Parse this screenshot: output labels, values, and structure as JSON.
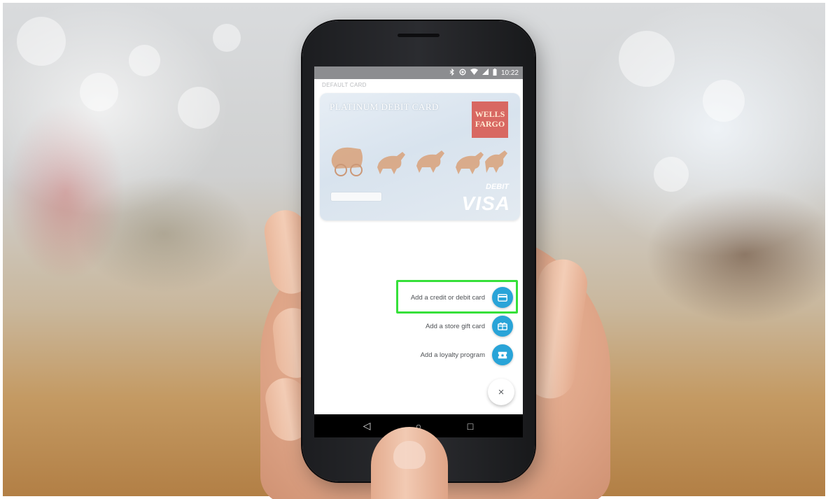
{
  "status_bar": {
    "time": "10:22",
    "icons": [
      "bluetooth-icon",
      "data-saver-icon",
      "wifi-icon",
      "signal-icon",
      "battery-icon"
    ]
  },
  "screen": {
    "section_label": "DEFAULT CARD"
  },
  "card": {
    "name": "PLATINUM DEBIT CARD",
    "bank_logo": "WELLS FARGO",
    "type_label": "DEBIT",
    "network": "VISA"
  },
  "menu": {
    "items": [
      {
        "label": "Add a credit or debit card",
        "icon": "credit-card-icon"
      },
      {
        "label": "Add a store gift card",
        "icon": "gift-card-icon"
      },
      {
        "label": "Add a loyalty program",
        "icon": "loyalty-ticket-icon"
      }
    ],
    "close_glyph": "×"
  },
  "nav_bar": {
    "back": "◁",
    "home": "○",
    "recents": "□"
  },
  "colors": {
    "accent": "#29a4d8",
    "highlight": "#36e03a",
    "bank_logo_bg": "#d86862",
    "status_bar_bg": "#8c8d90"
  }
}
